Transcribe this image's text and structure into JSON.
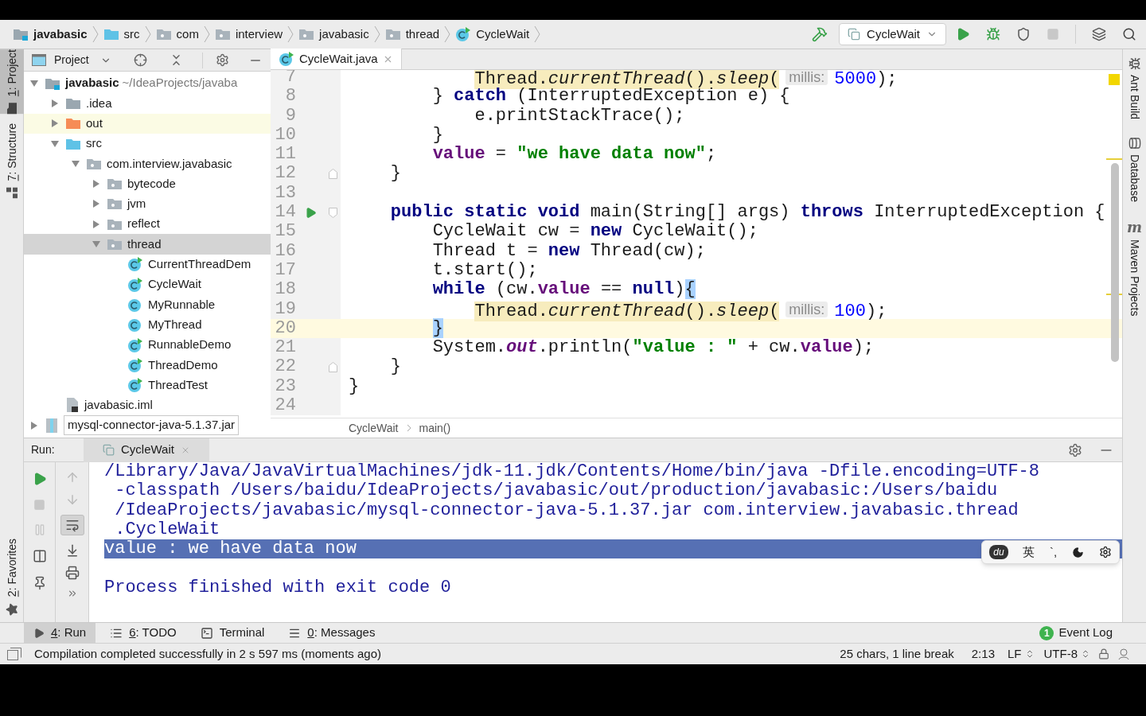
{
  "navigation_bar": {
    "breadcrumbs": [
      {
        "kind": "module",
        "label": "javabasic"
      },
      {
        "kind": "source_folder",
        "label": "src"
      },
      {
        "kind": "package",
        "label": "com"
      },
      {
        "kind": "package",
        "label": "interview"
      },
      {
        "kind": "package",
        "label": "javabasic"
      },
      {
        "kind": "package",
        "label": "thread"
      },
      {
        "kind": "class",
        "label": "CycleWait"
      }
    ],
    "run_configuration": "CycleWait"
  },
  "left_stripe": {
    "top": [
      {
        "kind": "project",
        "label": "1: Project",
        "selected": true,
        "underline_first": true
      },
      {
        "kind": "structure",
        "label": "7: Structure",
        "selected": false,
        "underline_first": true
      }
    ],
    "bottom": [
      {
        "kind": "favorites",
        "label": "2: Favorites",
        "selected": false,
        "underline_first": true
      }
    ]
  },
  "right_stripe": [
    {
      "kind": "ant",
      "label": "Ant Build"
    },
    {
      "kind": "database",
      "label": "Database"
    },
    {
      "kind": "maven",
      "label": "Maven Projects",
      "icon_text": "m"
    }
  ],
  "project_panel": {
    "title": "Project",
    "tree": [
      {
        "kind": "module",
        "label": "javabasic",
        "hint": "~/IdeaProjects/javaba",
        "expanded": true,
        "selected": false,
        "children": [
          {
            "kind": "folder",
            "label": ".idea",
            "expanded": false,
            "selected": false
          },
          {
            "kind": "output_folder",
            "label": "out",
            "expanded": false,
            "selected": false
          },
          {
            "kind": "source_folder",
            "label": "src",
            "expanded": true,
            "selected": false,
            "children": [
              {
                "kind": "package",
                "label": "com.interview.javabasic",
                "expanded": true,
                "selected": false,
                "children": [
                  {
                    "kind": "package",
                    "label": "bytecode",
                    "expanded": false,
                    "selected": false
                  },
                  {
                    "kind": "package",
                    "label": "jvm",
                    "expanded": false,
                    "selected": false
                  },
                  {
                    "kind": "package",
                    "label": "reflect",
                    "expanded": false,
                    "selected": false
                  },
                  {
                    "kind": "package",
                    "label": "thread",
                    "expanded": true,
                    "selected": true,
                    "children": [
                      {
                        "kind": "runnable_class",
                        "label": "CurrentThreadDem",
                        "selected": false
                      },
                      {
                        "kind": "runnable_class",
                        "label": "CycleWait",
                        "selected": false
                      },
                      {
                        "kind": "class",
                        "label": "MyRunnable",
                        "selected": false
                      },
                      {
                        "kind": "class",
                        "label": "MyThread",
                        "selected": false
                      },
                      {
                        "kind": "runnable_class",
                        "label": "RunnableDemo",
                        "selected": false
                      },
                      {
                        "kind": "runnable_class",
                        "label": "ThreadDemo",
                        "selected": false
                      },
                      {
                        "kind": "runnable_class",
                        "label": "ThreadTest",
                        "selected": false
                      }
                    ]
                  }
                ]
              }
            ]
          },
          {
            "kind": "iml",
            "label": "javabasic.iml",
            "selected": false
          }
        ]
      },
      {
        "kind": "jar",
        "label": "mysql-connector-java-5.1.37.jar",
        "expanded": false,
        "selected": false
      }
    ]
  },
  "editor": {
    "tabs": [
      {
        "label": "CycleWait.java",
        "selected": true
      }
    ],
    "lines": [
      {
        "number": "7",
        "caret": false,
        "segments": [
          {
            "kind": "warn",
            "text": "            Thread."
          },
          {
            "kind": "warn_method",
            "text": "currentThread"
          },
          {
            "kind": "warn",
            "text": "()."
          },
          {
            "kind": "warn_method",
            "text": "sleep"
          },
          {
            "kind": "warn",
            "text": "("
          },
          {
            "kind": "hint",
            "text": "millis:"
          },
          {
            "kind": "number",
            "text": "5000"
          },
          {
            "kind": "plain",
            "text": ");"
          }
        ]
      },
      {
        "number": "8",
        "caret": false,
        "segments": [
          {
            "kind": "plain",
            "text": "        } "
          },
          {
            "kind": "keyword",
            "text": "catch"
          },
          {
            "kind": "plain",
            "text": " (InterruptedException e) {"
          }
        ]
      },
      {
        "number": "9",
        "caret": false,
        "segments": [
          {
            "kind": "plain",
            "text": "            e.printStackTrace();"
          }
        ]
      },
      {
        "number": "10",
        "caret": false,
        "segments": [
          {
            "kind": "plain",
            "text": "        }"
          }
        ]
      },
      {
        "number": "11",
        "caret": false,
        "segments": [
          {
            "kind": "member",
            "text": "        value"
          },
          {
            "kind": "plain",
            "text": " = "
          },
          {
            "kind": "string",
            "text": "\"we have data now\""
          },
          {
            "kind": "plain",
            "text": ";"
          }
        ]
      },
      {
        "number": "12",
        "caret": false,
        "gutter": [
          {
            "kind": "fold_end"
          }
        ],
        "segments": [
          {
            "kind": "plain",
            "text": "    }"
          }
        ]
      },
      {
        "number": "13",
        "caret": false
      },
      {
        "number": "14",
        "caret": false,
        "gutter": [
          {
            "kind": "run"
          },
          {
            "kind": "fold_start"
          }
        ],
        "segments": [
          {
            "kind": "keyword",
            "text": "    public static void"
          },
          {
            "kind": "plain",
            "text": " main(String[] args) "
          },
          {
            "kind": "keyword",
            "text": "throws"
          },
          {
            "kind": "plain",
            "text": " InterruptedException {"
          }
        ]
      },
      {
        "number": "15",
        "caret": false,
        "segments": [
          {
            "kind": "plain",
            "text": "        CycleWait cw = "
          },
          {
            "kind": "keyword",
            "text": "new"
          },
          {
            "kind": "plain",
            "text": " CycleWait();"
          }
        ]
      },
      {
        "number": "16",
        "caret": false,
        "segments": [
          {
            "kind": "plain",
            "text": "        Thread t = "
          },
          {
            "kind": "keyword",
            "text": "new"
          },
          {
            "kind": "plain",
            "text": " Thread(cw);"
          }
        ]
      },
      {
        "number": "17",
        "caret": false,
        "segments": [
          {
            "kind": "plain",
            "text": "        t.start();"
          }
        ]
      },
      {
        "number": "18",
        "caret": false,
        "segments": [
          {
            "kind": "keyword",
            "text": "        while"
          },
          {
            "kind": "plain",
            "text": " (cw."
          },
          {
            "kind": "member",
            "text": "value"
          },
          {
            "kind": "plain",
            "text": " == "
          },
          {
            "kind": "keyword",
            "text": "null"
          },
          {
            "kind": "plain",
            "text": ")"
          },
          {
            "kind": "brace_match",
            "text": "{"
          }
        ]
      },
      {
        "number": "19",
        "caret": false,
        "segments": [
          {
            "kind": "warn",
            "text": "            Thread."
          },
          {
            "kind": "warn_method",
            "text": "currentThread"
          },
          {
            "kind": "warn",
            "text": "()."
          },
          {
            "kind": "warn_method",
            "text": "sleep"
          },
          {
            "kind": "warn",
            "text": "("
          },
          {
            "kind": "hint",
            "text": "millis:"
          },
          {
            "kind": "number",
            "text": "100"
          },
          {
            "kind": "plain",
            "text": ");"
          }
        ]
      },
      {
        "number": "20",
        "caret": true,
        "segments": [
          {
            "kind": "brace_match",
            "text": "        }"
          }
        ]
      },
      {
        "number": "21",
        "caret": false,
        "segments": [
          {
            "kind": "plain",
            "text": "        System."
          },
          {
            "kind": "static_field",
            "text": "out"
          },
          {
            "kind": "plain",
            "text": ".println("
          },
          {
            "kind": "string",
            "text": "\"value : \""
          },
          {
            "kind": "plain",
            "text": " + cw."
          },
          {
            "kind": "member",
            "text": "value"
          },
          {
            "kind": "plain",
            "text": ");"
          }
        ]
      },
      {
        "number": "22",
        "caret": false,
        "gutter": [
          {
            "kind": "fold_end"
          }
        ],
        "segments": [
          {
            "kind": "plain",
            "text": "    }"
          }
        ]
      },
      {
        "number": "23",
        "caret": false,
        "segments": [
          {
            "kind": "plain",
            "text": "}"
          }
        ]
      },
      {
        "number": "24",
        "caret": false
      }
    ],
    "breadcrumbs": [
      "CycleWait",
      "main()"
    ]
  },
  "run_panel": {
    "label": "Run:",
    "tabs": [
      {
        "label": "CycleWait",
        "selected": true
      }
    ],
    "soft_wrap_on": true,
    "console": [
      {
        "kind": "command",
        "text": "/Library/Java/JavaVirtualMachines/jdk-11.jdk/Contents/Home/bin/java -Dfile.encoding=UTF-8",
        "selected": false
      },
      {
        "kind": "command",
        "text": " -classpath /Users/baidu/IdeaProjects/javabasic/out/production/javabasic:/Users/baidu",
        "selected": false
      },
      {
        "kind": "command",
        "text": " /IdeaProjects/javabasic/mysql-connector-java-5.1.37.jar com.interview.javabasic.thread",
        "selected": false
      },
      {
        "kind": "command",
        "text": " .CycleWait",
        "selected": false
      },
      {
        "kind": "output",
        "text": "value : we have data now",
        "selected": true
      },
      {
        "kind": "exit",
        "text": "Process finished with exit code 0",
        "selected": false
      }
    ]
  },
  "ime_toolbar": {
    "logo_text": "du",
    "mode": "英",
    "punctuation": "`,"
  },
  "bottom_tabs": [
    {
      "kind": "run",
      "label": "4: Run",
      "selected": true,
      "underline_first": true
    },
    {
      "kind": "todo",
      "label": "6: TODO",
      "selected": false,
      "underline_first": true
    },
    {
      "kind": "terminal",
      "label": "Terminal",
      "selected": false,
      "underline_first": false
    },
    {
      "kind": "messages",
      "label": "0: Messages",
      "selected": false,
      "underline_first": true
    }
  ],
  "event_log": {
    "label": "Event Log",
    "count": "1"
  },
  "status_bar": {
    "message": "Compilation completed successfully in 2 s 597 ms (moments ago)",
    "selection": "25 chars, 1 line break",
    "position": "2:13",
    "line_separator": "LF",
    "encoding": "UTF-8"
  }
}
